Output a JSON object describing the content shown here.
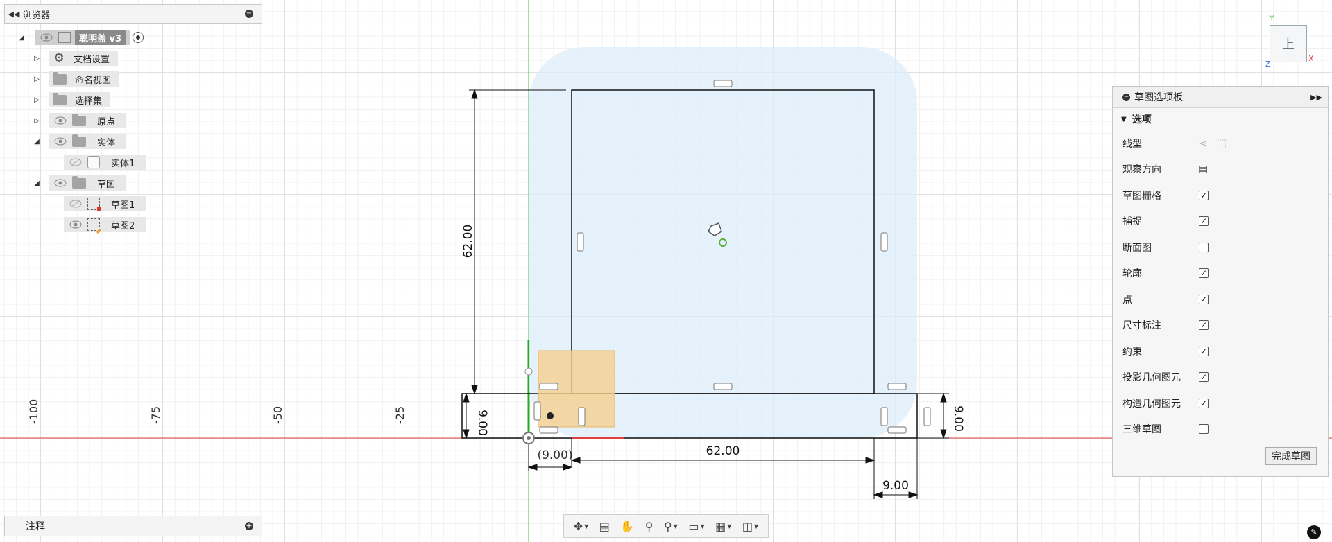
{
  "browser": {
    "title": "浏览器",
    "collapse_icon": "double-chevron-left-icon",
    "root": {
      "label": "聪明盖 v3"
    },
    "items": [
      {
        "label": "文档设置",
        "icon": "gear-icon"
      },
      {
        "label": "命名视图",
        "icon": "folder-icon"
      },
      {
        "label": "选择集",
        "icon": "folder-icon"
      },
      {
        "label": "原点",
        "icon": "folder-icon"
      },
      {
        "label": "实体",
        "icon": "folder-icon"
      },
      {
        "label": "实体1",
        "icon": "body-icon"
      },
      {
        "label": "草图",
        "icon": "folder-icon"
      },
      {
        "label": "草图1",
        "icon": "sketch-icon"
      },
      {
        "label": "草图2",
        "icon": "sketch-edit-icon"
      }
    ]
  },
  "notes": {
    "title": "注释"
  },
  "palette": {
    "title": "草图选项板",
    "section": "选项",
    "options": [
      {
        "label": "线型",
        "kind": "icons"
      },
      {
        "label": "观察方向",
        "kind": "icon"
      },
      {
        "label": "草图栅格",
        "checked": true
      },
      {
        "label": "捕捉",
        "checked": true
      },
      {
        "label": "断面图",
        "checked": false
      },
      {
        "label": "轮廓",
        "checked": true
      },
      {
        "label": "点",
        "checked": true
      },
      {
        "label": "尺寸标注",
        "checked": true
      },
      {
        "label": "约束",
        "checked": true
      },
      {
        "label": "投影几何图元",
        "checked": true
      },
      {
        "label": "构造几何图元",
        "checked": true
      },
      {
        "label": "三维草图",
        "checked": false
      }
    ],
    "finish_label": "完成草图"
  },
  "viewcube": {
    "face": "上",
    "axis_x": "X",
    "axis_y": "Y",
    "axis_z": "Z"
  },
  "ruler": [
    "-100",
    "-75",
    "-50",
    "-25"
  ],
  "dimensions": {
    "height_left": "62.00",
    "width_bottom": "62.00",
    "small_left": "9.00",
    "small_right": "9.00",
    "offset_left": "(9.00)",
    "width_right": "9.00"
  },
  "colors": {
    "accent": "#0696d7",
    "x_axis": "#e0403a",
    "y_axis": "#3bc43b",
    "fill": "#ddeef9"
  }
}
